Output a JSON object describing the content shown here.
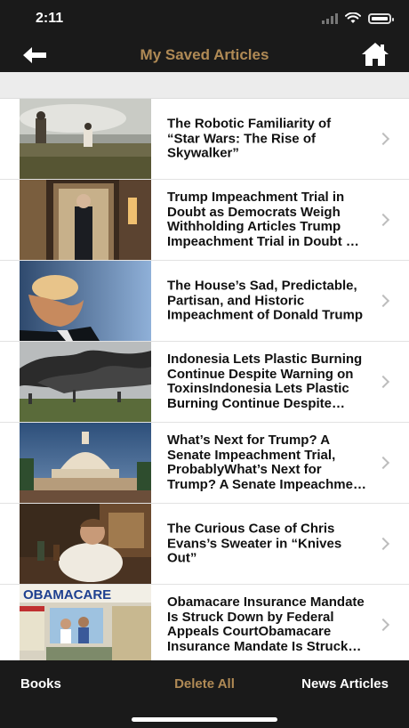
{
  "status": {
    "time": "2:11"
  },
  "nav": {
    "title": "My Saved Articles",
    "back_icon": "back-arrow-icon",
    "home_icon": "home-icon"
  },
  "articles": [
    {
      "title": "The Robotic Familiarity of “Star Wars: The Rise of Skywalker”"
    },
    {
      "title": "Trump Impeachment Trial in Doubt as Democrats Weigh Withholding Articles Trump Impeachment Trial in Doubt as Democrats Weigh Withholding Articles"
    },
    {
      "title": "The House’s Sad, Predictable, Partisan, and Historic Impeachment of Donald Trump"
    },
    {
      "title": "Indonesia Lets Plastic Burning Continue Despite Warning on ToxinsIndonesia Lets Plastic Burning Continue Despite Warning on Toxins"
    },
    {
      "title": "What’s Next for Trump? A Senate Impeachment Trial, ProbablyWhat’s Next for Trump? A Senate Impeachment Trial, Probably"
    },
    {
      "title": "The Curious Case of Chris Evans’s Sweater in “Knives Out”"
    },
    {
      "title": "Obamacare Insurance Mandate Is Struck Down by Federal Appeals CourtObamacare Insurance Mandate Is Struck Down by Federal Appeals Court"
    }
  ],
  "thumb_labels": {
    "obamacare": "OBAMACARE"
  },
  "tabs": {
    "books": "Books",
    "delete": "Delete All",
    "news": "News Articles"
  },
  "colors": {
    "accent": "#b08a55",
    "bar": "#1a1a1a"
  }
}
